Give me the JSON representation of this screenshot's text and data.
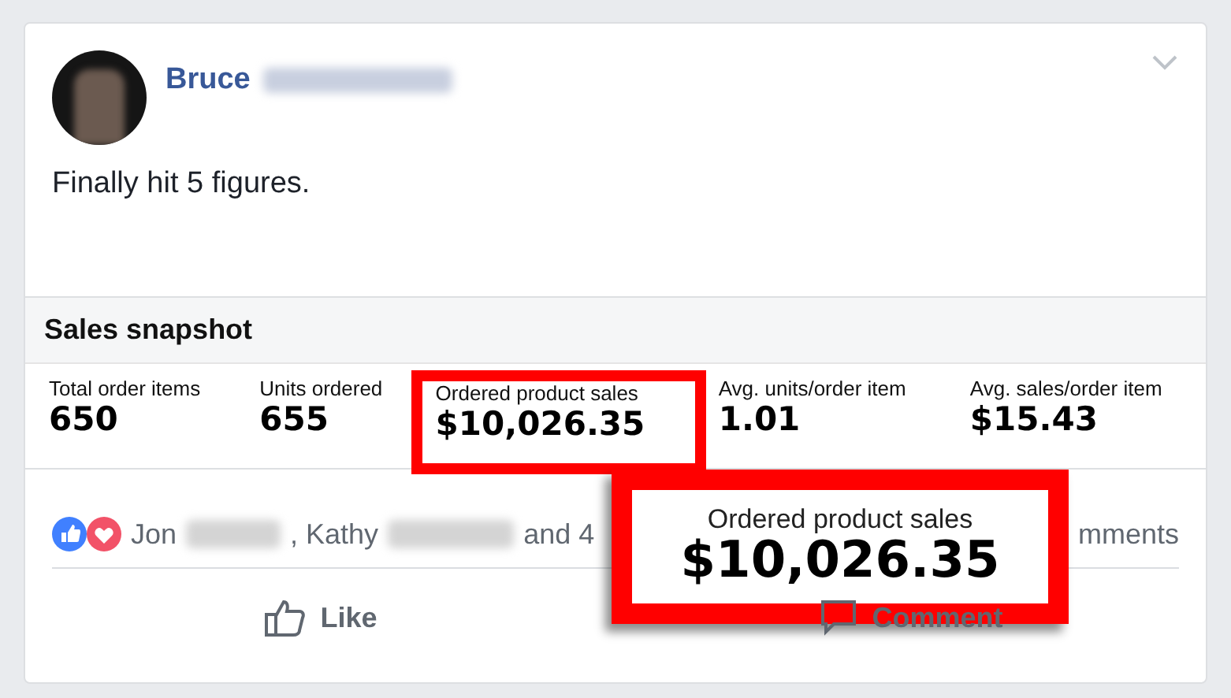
{
  "post": {
    "author": "Bruce",
    "text": "Finally hit 5 figures."
  },
  "snapshot": {
    "title": "Sales snapshot",
    "metrics": [
      {
        "label": "Total order items",
        "value": "650",
        "highlighted": false
      },
      {
        "label": "Units ordered",
        "value": "655",
        "highlighted": false
      },
      {
        "label": "Ordered product sales",
        "value": "$10,026.35",
        "highlighted": true
      },
      {
        "label": "Avg. units/order item",
        "value": "1.01",
        "highlighted": false
      },
      {
        "label": "Avg. sales/order item",
        "value": "$15.43",
        "highlighted": false
      }
    ]
  },
  "callout": {
    "label": "Ordered product sales",
    "value": "$10,026.35"
  },
  "reactions": {
    "names": [
      "Jon",
      ", Kathy"
    ],
    "tail": "and 4",
    "comments": "mments"
  },
  "actions": [
    {
      "kind": "like",
      "label": "Like"
    },
    {
      "kind": "comment",
      "label": "Comment"
    }
  ]
}
